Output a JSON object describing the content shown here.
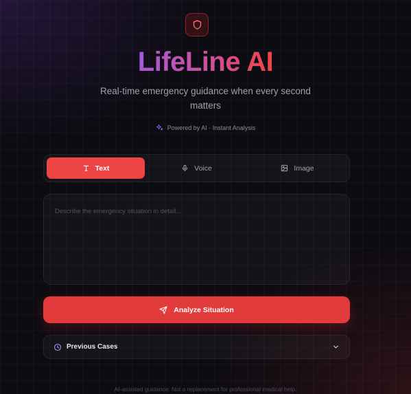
{
  "app": {
    "title": "LifeLine AI",
    "subtitle": "Real-time emergency guidance when every second matters",
    "powered_by": "Powered by AI · Instant Analysis"
  },
  "tabs": [
    {
      "label": "Text",
      "icon": "text-icon",
      "active": true
    },
    {
      "label": "Voice",
      "icon": "mic-icon",
      "active": false
    },
    {
      "label": "Image",
      "icon": "image-icon",
      "active": false
    }
  ],
  "input": {
    "value": "",
    "placeholder": "Describe the emergency situation in detail..."
  },
  "analyze_button": {
    "label": "Analyze Situation",
    "icon": "send-icon"
  },
  "previous_cases": {
    "label": "Previous Cases",
    "icon": "clock-icon",
    "expanded": false
  },
  "footer": {
    "disclaimer": "AI-assisted guidance. Not a replacement for professional medical help."
  },
  "colors": {
    "accent": "#ef4444",
    "gradient_start": "#a55ad8",
    "gradient_end": "#ef4444",
    "background": "#0d0c12",
    "muted_text": "#a1a1aa"
  }
}
